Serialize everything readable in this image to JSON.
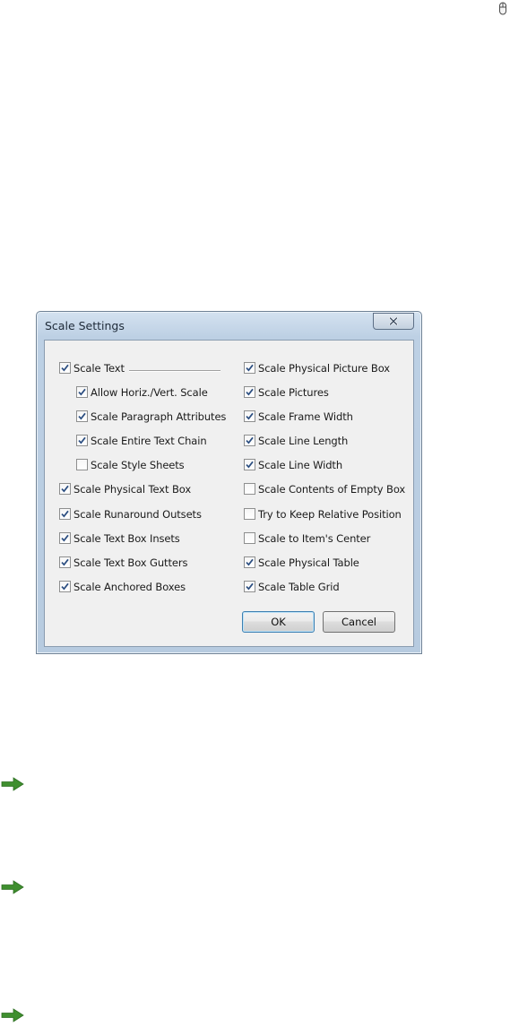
{
  "dialog": {
    "title": "Scale Settings",
    "close_glyph": "✕",
    "left_column": [
      {
        "label": "Scale Text",
        "checked": true,
        "indent": false
      },
      {
        "label": "Allow Horiz./Vert. Scale",
        "checked": true,
        "indent": true
      },
      {
        "label": "Scale Paragraph Attributes",
        "checked": true,
        "indent": true
      },
      {
        "label": "Scale Entire Text Chain",
        "checked": true,
        "indent": true
      },
      {
        "label": "Scale Style Sheets",
        "checked": false,
        "indent": true
      },
      {
        "label": "Scale Physical Text Box",
        "checked": true,
        "indent": false
      },
      {
        "label": "Scale Runaround Outsets",
        "checked": true,
        "indent": false
      },
      {
        "label": "Scale Text Box Insets",
        "checked": true,
        "indent": false
      },
      {
        "label": "Scale Text Box Gutters",
        "checked": true,
        "indent": false
      },
      {
        "label": "Scale Anchored Boxes",
        "checked": true,
        "indent": false
      }
    ],
    "right_column": [
      {
        "label": "Scale Physical Picture Box",
        "checked": true
      },
      {
        "label": "Scale Pictures",
        "checked": true
      },
      {
        "label": "Scale Frame Width",
        "checked": true
      },
      {
        "label": "Scale Line Length",
        "checked": true
      },
      {
        "label": "Scale Line Width",
        "checked": true
      },
      {
        "label": "Scale Contents of Empty Box",
        "checked": false
      },
      {
        "label": "Try to Keep Relative Position",
        "checked": false
      },
      {
        "label": "Scale to Item's Center",
        "checked": false
      },
      {
        "label": "Scale Physical Table",
        "checked": true
      },
      {
        "label": "Scale Table Grid",
        "checked": true
      }
    ],
    "ok_label": "OK",
    "cancel_label": "Cancel"
  },
  "colors": {
    "arrow": "#3f8f2f",
    "checkmark": "#2a4d80"
  },
  "icons": {
    "corner": "mouse-icon",
    "arrow": "green-right-arrow-icon"
  }
}
